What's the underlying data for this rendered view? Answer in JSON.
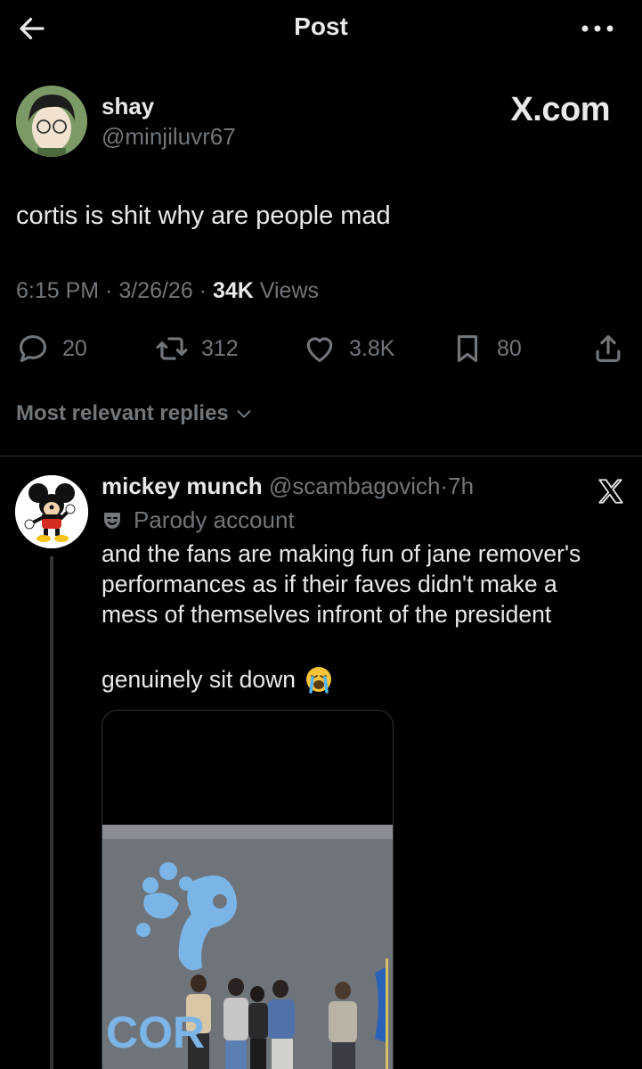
{
  "topbar": {
    "title": "Post",
    "back_icon": "arrow-left-icon",
    "more_icon": "more-horizontal-icon"
  },
  "post": {
    "author_name": "shay",
    "author_handle": "@minjiluvr67",
    "watermark": "X.com",
    "text": "cortis is shit why are people mad",
    "meta_prefix": "6:15 PM · 3/26/26 · ",
    "views_count": "34K",
    "views_label": " Views",
    "actions": {
      "replies": "20",
      "reposts": "312",
      "likes": "3.8K",
      "bookmarks": "80"
    }
  },
  "replies_sort": {
    "label": "Most relevant replies",
    "icon": "chevron-down-icon"
  },
  "reply": {
    "name": "mickey munch",
    "handle": "@scambagovich",
    "dot": "·",
    "time": "7h",
    "parody_label": "Parody account",
    "body": "and the fans are making fun of jane remover's performances as if their faves didn't make a mess of themselves infront of the president",
    "tail": "genuinely sit down",
    "emoji": "loudly-crying-face-emoji",
    "media_overlay_text": "COR"
  },
  "colors": {
    "background": "#000000",
    "text_primary": "#e7e9ea",
    "text_secondary": "#71767b",
    "divider": "#2f3336"
  }
}
